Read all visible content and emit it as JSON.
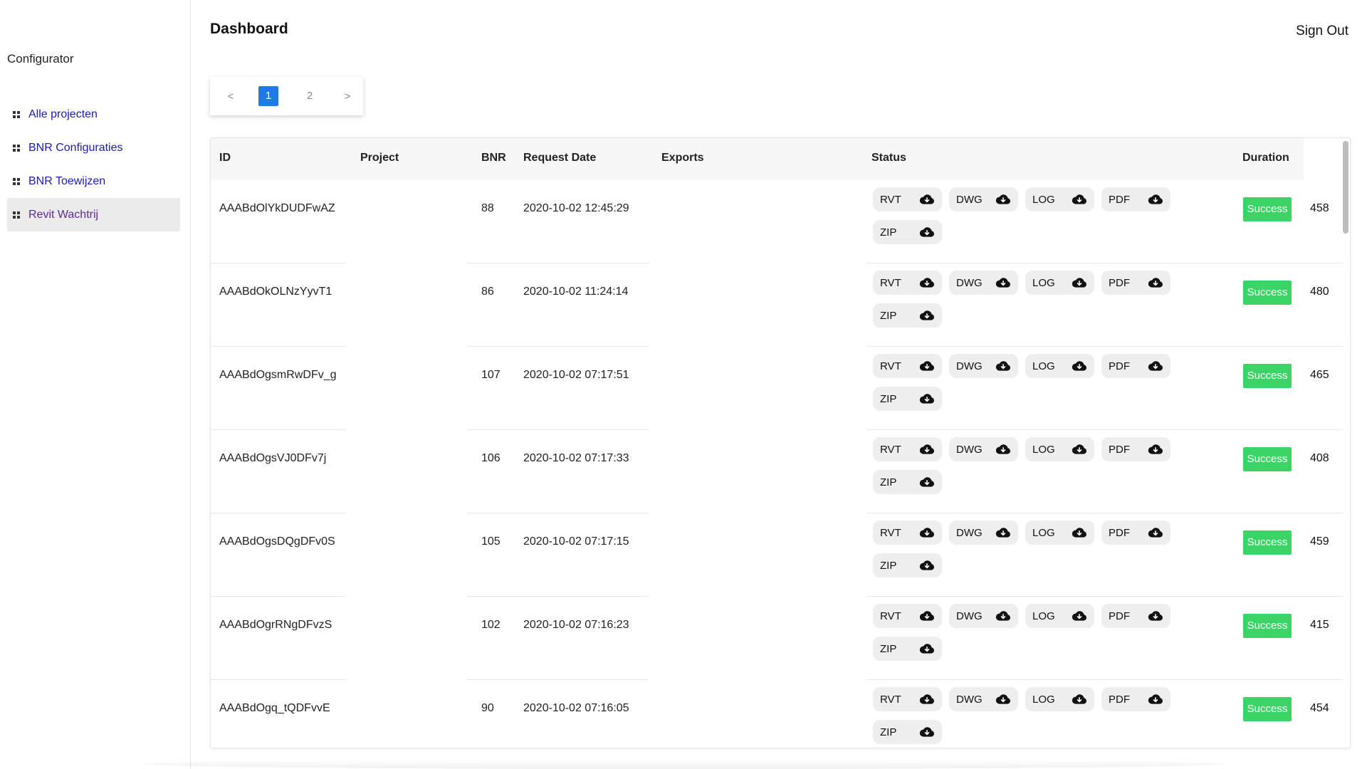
{
  "sidebar": {
    "brand": "Configurator",
    "items": [
      {
        "label": "Alle projecten",
        "icon": "grid-icon"
      },
      {
        "label": "BNR Configuraties",
        "icon": "grid-icon"
      },
      {
        "label": "BNR Toewijzen",
        "icon": "grid-icon"
      },
      {
        "label": "Revit Wachtrij",
        "icon": "grid-icon",
        "active": true
      }
    ]
  },
  "header": {
    "title": "Dashboard",
    "signout": "Sign Out"
  },
  "pagination": {
    "prev": "<",
    "pages": [
      "1",
      "2"
    ],
    "current": "1",
    "next": ">"
  },
  "table": {
    "columns": {
      "id": "ID",
      "project": "Project",
      "bnr": "BNR",
      "request_date": "Request Date",
      "exports": "Exports",
      "status": "Status",
      "duration": "Duration"
    },
    "rows": [
      {
        "id": "AAABdOlYkDUDFwAZ",
        "project": "",
        "bnr": "88",
        "request_date": "2020-10-02 12:45:29",
        "files": [
          "RVT",
          "DWG",
          "LOG",
          "PDF",
          "ZIP"
        ],
        "status": "Success",
        "duration": "458"
      },
      {
        "id": "AAABdOkOLNzYyvT1",
        "project": "",
        "bnr": "86",
        "request_date": "2020-10-02 11:24:14",
        "files": [
          "RVT",
          "DWG",
          "LOG",
          "PDF",
          "ZIP"
        ],
        "status": "Success",
        "duration": "480"
      },
      {
        "id": "AAABdOgsmRwDFv_g",
        "project": "",
        "bnr": "107",
        "request_date": "2020-10-02 07:17:51",
        "files": [
          "RVT",
          "DWG",
          "LOG",
          "PDF",
          "ZIP"
        ],
        "status": "Success",
        "duration": "465"
      },
      {
        "id": "AAABdOgsVJ0DFv7j",
        "project": "",
        "bnr": "106",
        "request_date": "2020-10-02 07:17:33",
        "files": [
          "RVT",
          "DWG",
          "LOG",
          "PDF",
          "ZIP"
        ],
        "status": "Success",
        "duration": "408"
      },
      {
        "id": "AAABdOgsDQgDFv0S",
        "project": "",
        "bnr": "105",
        "request_date": "2020-10-02 07:17:15",
        "files": [
          "RVT",
          "DWG",
          "LOG",
          "PDF",
          "ZIP"
        ],
        "status": "Success",
        "duration": "459"
      },
      {
        "id": "AAABdOgrRNgDFvzS",
        "project": "",
        "bnr": "102",
        "request_date": "2020-10-02 07:16:23",
        "files": [
          "RVT",
          "DWG",
          "LOG",
          "PDF",
          "ZIP"
        ],
        "status": "Success",
        "duration": "415"
      },
      {
        "id": "AAABdOgq_tQDFvvE",
        "project": "",
        "bnr": "90",
        "request_date": "2020-10-02 07:16:05",
        "files": [
          "RVT",
          "DWG",
          "LOG",
          "PDF",
          "ZIP"
        ],
        "status": "Success",
        "duration": "454"
      }
    ]
  },
  "colors": {
    "accent": "#1e7be6",
    "success": "#3dd467",
    "link": "#1b1bb5",
    "active_link": "#5c2a8c"
  }
}
